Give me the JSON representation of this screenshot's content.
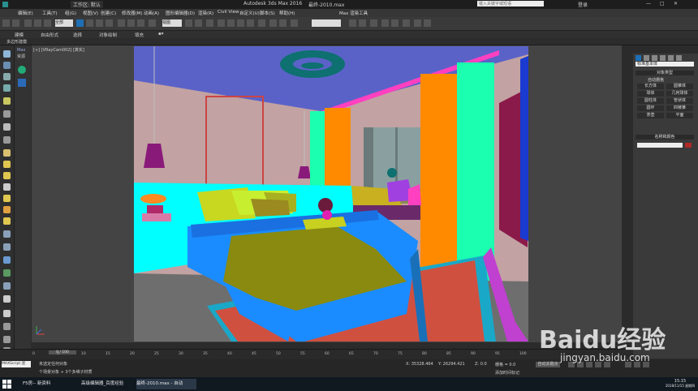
{
  "window": {
    "title": "Autodesk 3ds Max 2016",
    "file": "最终-2010.max",
    "workspace": "工作区: 默认",
    "search_placeholder": "键入关键字或短语",
    "user": "登录"
  },
  "menu": [
    "编辑(E)",
    "工具(T)",
    "组(G)",
    "视图(V)",
    "创建(C)",
    "修改器(M)",
    "动画(A)",
    "图形编辑器(D)",
    "渲染(R)",
    "Civil View",
    "自定义(U)",
    "脚本(S)",
    "帮助(H)",
    "Max 渲染工具"
  ],
  "toolbar": {
    "select_all": "全部",
    "view": "视图"
  },
  "ribbon": {
    "tabs": [
      "建模",
      "自由形式",
      "选择",
      "对象绘制",
      "填充"
    ],
    "sub": "多边形建模"
  },
  "viewport": {
    "label": "[+] [VRayCam002] [真实]"
  },
  "side": {
    "label_max": "Max",
    "label_scene": "资源"
  },
  "command_panel": {
    "dropdown": "标准基本体",
    "rollout_object_type": "对象类型",
    "auto_grid": "自动栅格",
    "buttons": [
      "长方体",
      "圆锥体",
      "球体",
      "几何球体",
      "圆柱体",
      "管状体",
      "圆环",
      "四棱锥",
      "茶壶",
      "平面"
    ],
    "rollout_name_color": "名称和颜色"
  },
  "timeline": {
    "frame": "0 / 100",
    "ticks": [
      "0",
      "5",
      "10",
      "15",
      "20",
      "25",
      "30",
      "35",
      "40",
      "45",
      "50",
      "55",
      "60",
      "65",
      "70",
      "75",
      "80",
      "85",
      "90",
      "95",
      "100"
    ]
  },
  "status": {
    "maxscript": "MAXScript 迷",
    "line1": "未选定任何对象",
    "line2": "个场景对象 + 3个多维子材质",
    "coords_x": "X: 35328.464",
    "coords_y": "Y: 26294.421",
    "coords_z": "Z: 0.0",
    "grid": "栅格 = 0.0",
    "add_time_tag": "添加时间标记",
    "auto_key": "自动关键点"
  },
  "taskbar": {
    "items": [
      "F5房-- 新资料",
      "高级编辑器_百度经验",
      "最终-2010.max - 自动"
    ],
    "time": "15:15",
    "date": "2018/11/15 星期四"
  },
  "watermark": {
    "text": "Baidu经验",
    "url": "jingyan.baidu.com"
  },
  "colors": {
    "ceiling": "#5a62c8",
    "wall": "#c2a2a2",
    "floor": "#6e6e6e",
    "bed": "#1a8cff",
    "cyan": "#00ffff",
    "orange": "#ff8a00",
    "mint": "#1affb0",
    "rug": "#d05040"
  }
}
